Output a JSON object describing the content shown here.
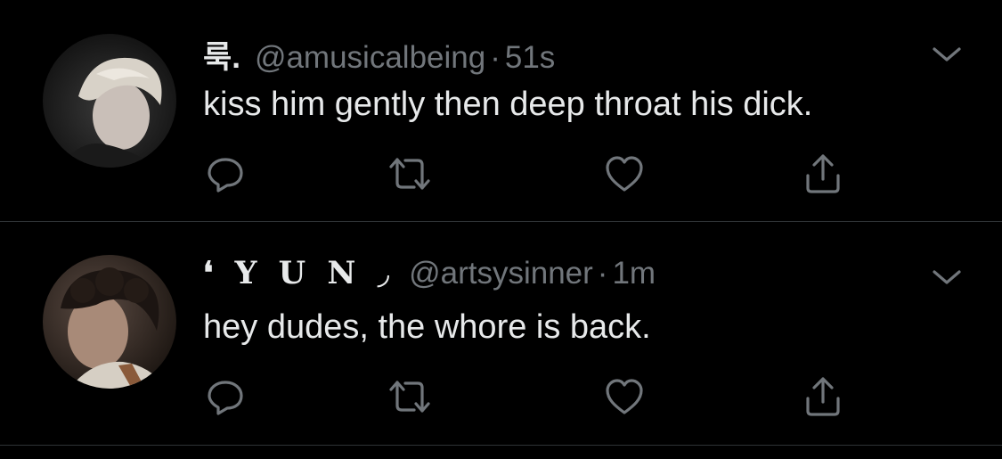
{
  "tweets": [
    {
      "display_name": "룩.",
      "handle": "@amusicalbeing",
      "separator": "·",
      "time": "51s",
      "text": "kiss him gently then deep throat his dick."
    },
    {
      "display_name": "❛ Y U N ◞",
      "handle": "@artsysinner",
      "separator": "·",
      "time": "1m",
      "text": "hey dudes, the whore is back."
    }
  ],
  "icons": {
    "reply": "reply-icon",
    "retweet": "retweet-icon",
    "like": "heart-icon",
    "share": "share-icon",
    "menu": "chevron-down-icon"
  },
  "colors": {
    "background": "#000000",
    "text_primary": "#e7e9ea",
    "text_secondary": "#71767b",
    "divider": "#2f3336"
  }
}
